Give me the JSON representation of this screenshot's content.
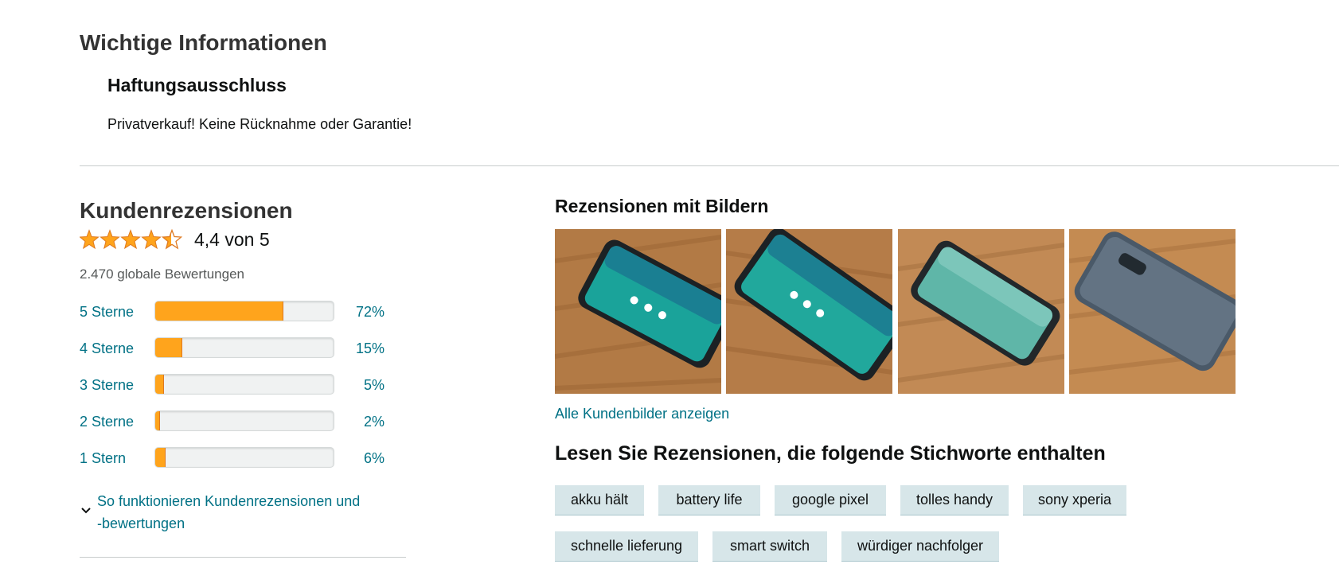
{
  "info": {
    "title": "Wichtige Informationen",
    "subtitle": "Haftungsausschluss",
    "text": "Privatverkauf! Keine Rücknahme oder Garantie!"
  },
  "reviews": {
    "title": "Kundenrezensionen",
    "rating_value": 4.4,
    "rating_text": "4,4 von 5",
    "global_count": "2.470 globale Bewertungen",
    "histogram": [
      {
        "label": "5 Sterne",
        "percent": 72,
        "percent_text": "72%"
      },
      {
        "label": "4 Sterne",
        "percent": 15,
        "percent_text": "15%"
      },
      {
        "label": "3 Sterne",
        "percent": 5,
        "percent_text": "5%"
      },
      {
        "label": "2 Sterne",
        "percent": 2,
        "percent_text": "2%"
      },
      {
        "label": "1 Stern",
        "percent": 6,
        "percent_text": "6%"
      }
    ],
    "howto_line1": "So funktionieren Kundenrezensionen und",
    "howto_line2": "-bewertungen"
  },
  "images": {
    "title": "Rezensionen mit Bildern",
    "all_link": "Alle Kundenbilder anzeigen"
  },
  "keywords": {
    "title": "Lesen Sie Rezensionen, die folgende Stichworte enthalten",
    "chips": [
      "akku hält",
      "battery life",
      "google pixel",
      "tolles handy",
      "sony xperia",
      "schnelle lieferung",
      "smart switch",
      "würdiger nachfolger"
    ]
  },
  "colors": {
    "star": "#ffa41c",
    "link": "#007185",
    "chip_bg": "#d7e6e9"
  }
}
